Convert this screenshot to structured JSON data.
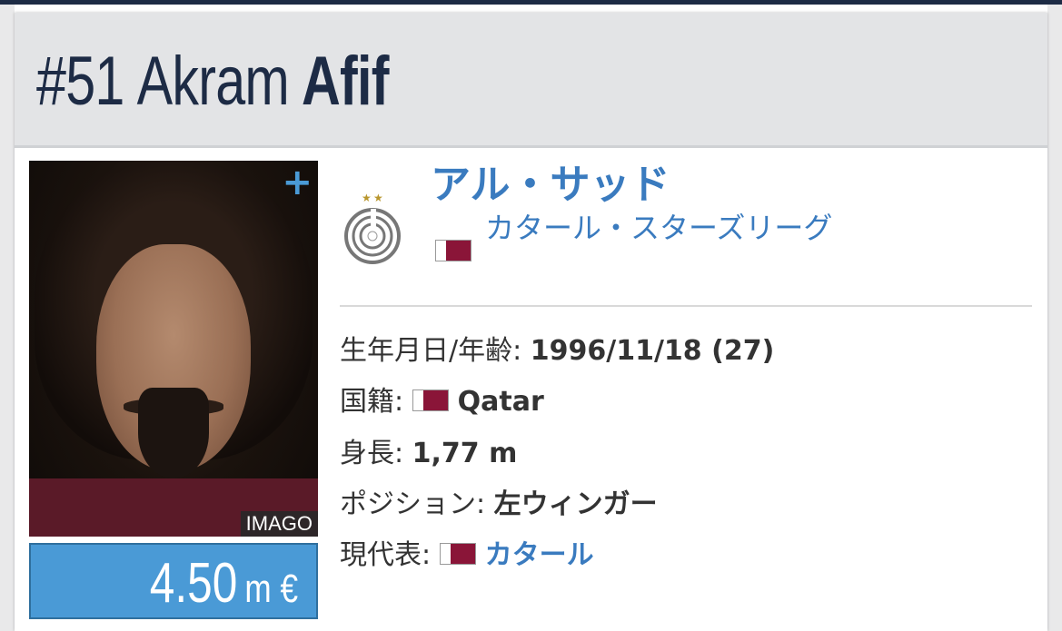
{
  "header": {
    "number": "#51",
    "first_name": "Akram",
    "last_name": "Afif"
  },
  "photo": {
    "credit": "IMAGO",
    "expand_icon": "plus-icon"
  },
  "market_value": {
    "amount": "4.50",
    "unit": "m €"
  },
  "club": {
    "name": "アル・サッド",
    "league": "カタール・スターズリーグ"
  },
  "info": {
    "birth_label": "生年月日/年齢:",
    "birth_value": "1996/11/18 (27)",
    "nationality_label": "国籍:",
    "nationality_value": "Qatar",
    "height_label": "身長:",
    "height_value": "1,77 m",
    "position_label": "ポジション:",
    "position_value": "左ウィンガー",
    "national_team_label": "現代表:",
    "national_team_value": "カタール"
  },
  "colors": {
    "title": "#1d2b45",
    "link": "#3a7bbf",
    "value_box": "#4a9ad6",
    "flag_maroon": "#8a1538"
  }
}
